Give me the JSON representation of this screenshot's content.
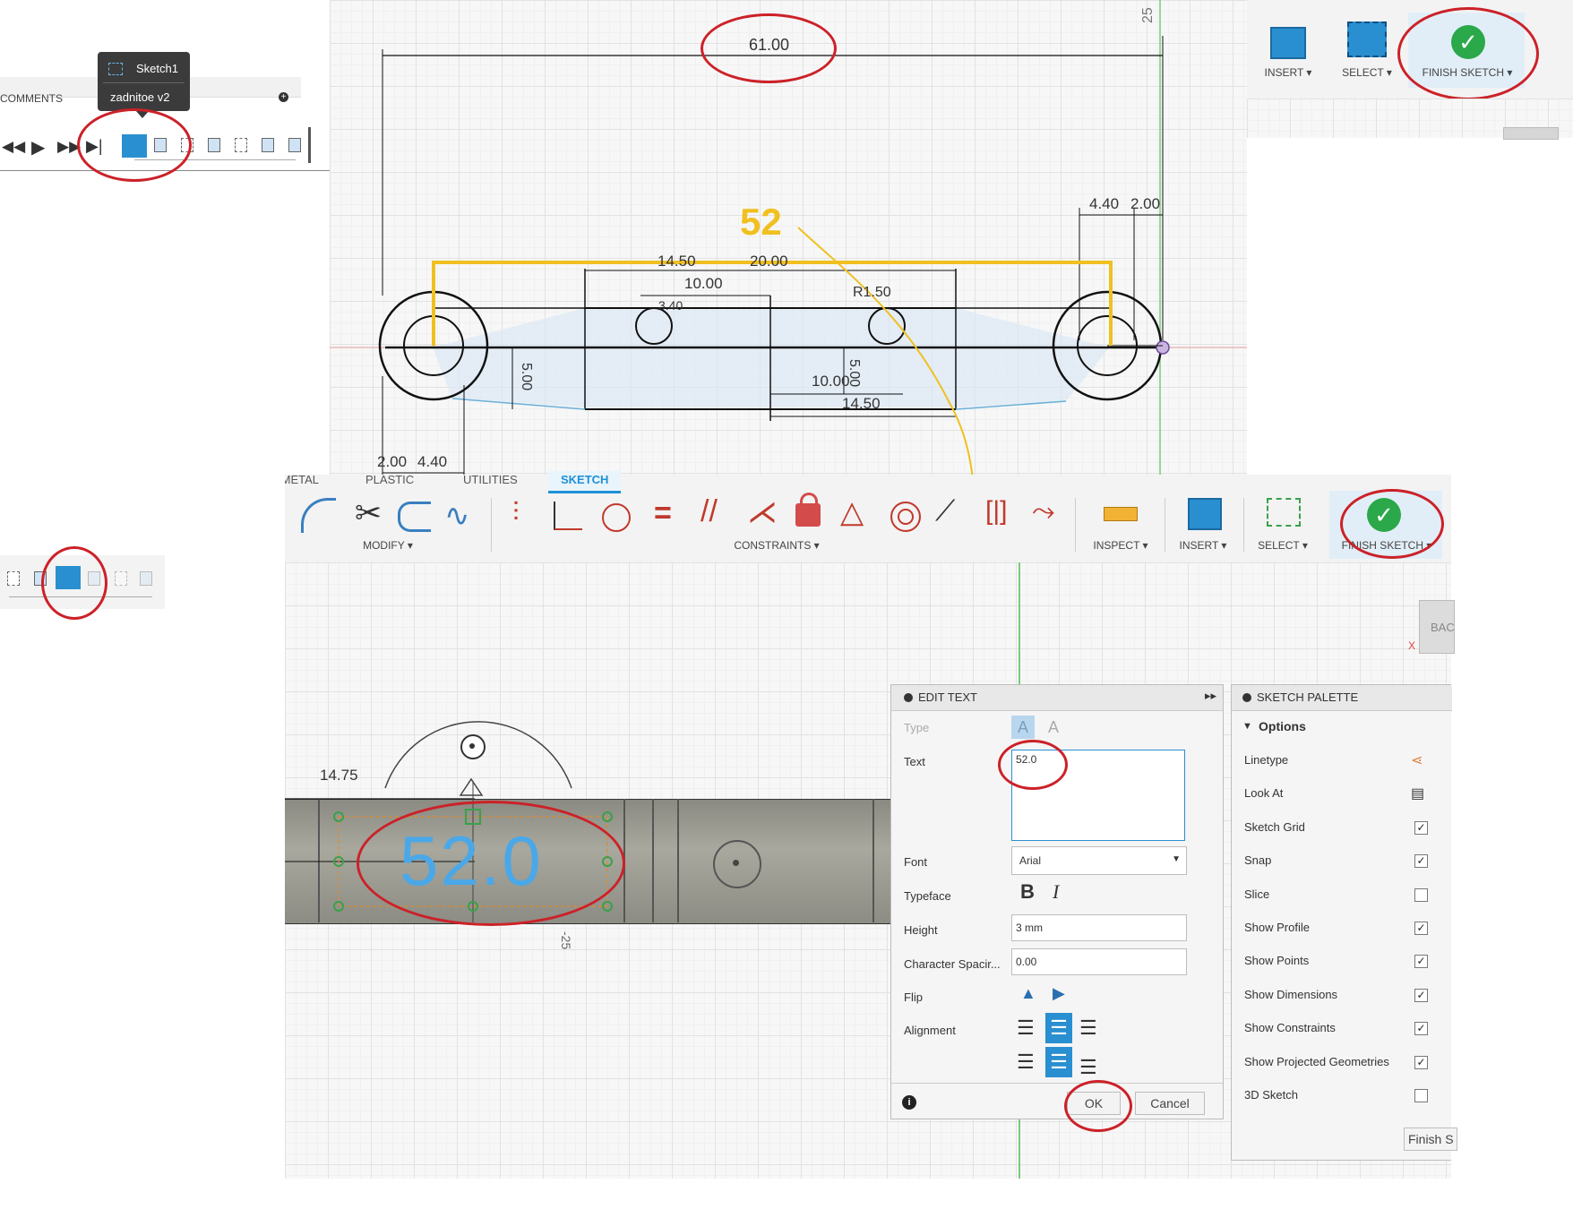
{
  "top_browser": {
    "comments_label": "COMMENTS",
    "tooltip_sketch": "Sketch1",
    "tooltip_file": "zadnitoe v2"
  },
  "top_toolbar": {
    "insert_label": "INSERT ▾",
    "select_label": "SELECT ▾",
    "finish_label": "FINISH SKETCH ▾"
  },
  "drawing": {
    "dim_overall": "61.00",
    "dim_top_25": "25",
    "dim_440_right": "4.40",
    "dim_200_right": "2.00",
    "dim_1450_a": "14.50",
    "dim_2000": "20.00",
    "dim_1000_a": "10.00",
    "dim_r150": "R1.50",
    "dim_3_40": "3.40",
    "dim_500_left": "5.00",
    "dim_500_right": "5.00",
    "dim_1000_b": "10.00",
    "dim_1450_b": "14.50",
    "dim_200_left": "2.00",
    "dim_440_left": "4.40",
    "annotation_52": "52"
  },
  "ribbon": {
    "tabs": [
      "METAL",
      "PLASTIC",
      "UTILITIES",
      "SKETCH"
    ],
    "modify_label": "MODIFY ▾",
    "constraints_label": "CONSTRAINTS ▾",
    "inspect_label": "INSPECT ▾",
    "insert_label": "INSERT ▾",
    "select_label": "SELECT ▾",
    "finish_label": "FINISH SKETCH ▾"
  },
  "viewcube_label": "BAC",
  "viewcube_axis": "X",
  "lower_view": {
    "dim_1475": "14.75",
    "text_entity": "52.0",
    "axis_25": "-25"
  },
  "edit_text": {
    "title": "EDIT TEXT",
    "type_label": "Type",
    "text_label": "Text",
    "text_value": "52.0",
    "font_label": "Font",
    "font_value": "Arial",
    "typeface_label": "Typeface",
    "bold_glyph": "B",
    "italic_glyph": "I",
    "height_label": "Height",
    "height_value": "3 mm",
    "spacing_label": "Character Spacir...",
    "spacing_value": "0.00",
    "flip_label": "Flip",
    "alignment_label": "Alignment",
    "ok_label": "OK",
    "cancel_label": "Cancel"
  },
  "sketch_palette": {
    "title": "SKETCH PALETTE",
    "section": "Options",
    "rows": [
      {
        "label": "Linetype",
        "kind": "icon"
      },
      {
        "label": "Look At",
        "kind": "icon"
      },
      {
        "label": "Sketch Grid",
        "kind": "check",
        "checked": true
      },
      {
        "label": "Snap",
        "kind": "check",
        "checked": true
      },
      {
        "label": "Slice",
        "kind": "check",
        "checked": false
      },
      {
        "label": "Show Profile",
        "kind": "check",
        "checked": true
      },
      {
        "label": "Show Points",
        "kind": "check",
        "checked": true
      },
      {
        "label": "Show Dimensions",
        "kind": "check",
        "checked": true
      },
      {
        "label": "Show Constraints",
        "kind": "check",
        "checked": true
      },
      {
        "label": "Show Projected Geometries",
        "kind": "check",
        "checked": true
      },
      {
        "label": "3D Sketch",
        "kind": "check",
        "checked": false
      }
    ],
    "finish_button": "Finish S"
  },
  "colors": {
    "accent_blue": "#1e90d8",
    "annotation_red": "#cc2128",
    "annotation_yellow": "#f0c020",
    "finish_green": "#2aa84a"
  }
}
